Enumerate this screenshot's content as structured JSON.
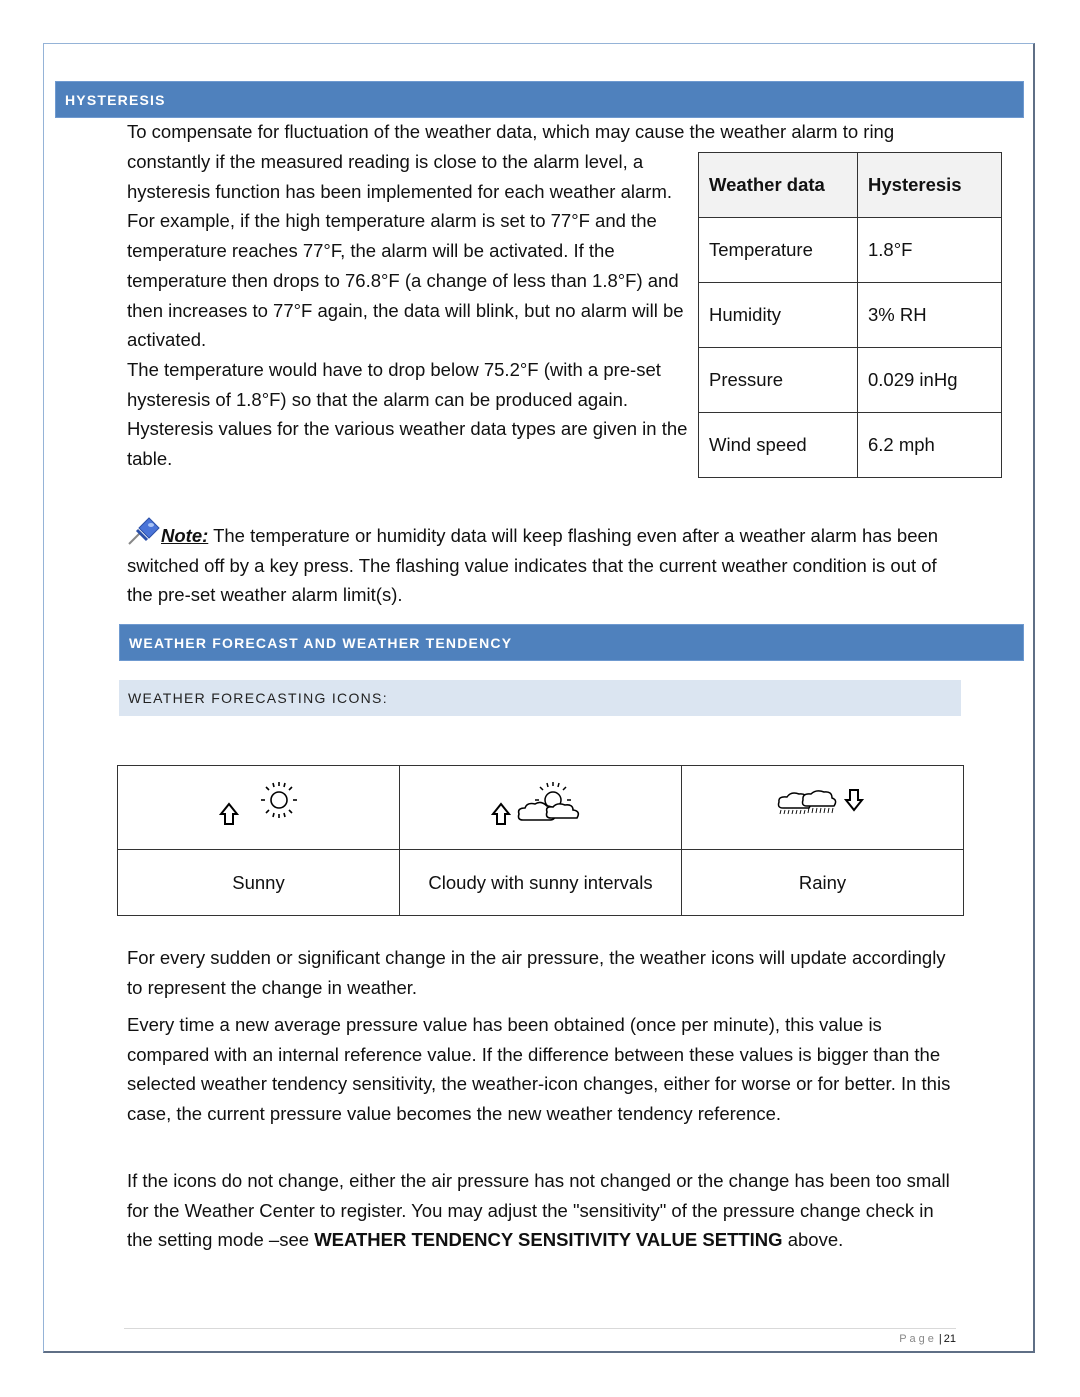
{
  "sections": {
    "hysteresis_title": "HYSTERESIS",
    "forecast_title": "WEATHER FORECAST AND WEATHER TENDENCY",
    "icons_subtitle": "WEATHER FORECASTING ICONS:"
  },
  "hysteresis": {
    "intro_line": "To compensate for fluctuation of the weather data, which may cause the weather alarm to ring",
    "left_text_1": "constantly if the measured reading is close to the alarm level, a hysteresis function has been implemented for each weather alarm.",
    "left_text_2": "For example, if the high temperature alarm is set to 77°F and the temperature reaches 77°F, the alarm will be activated. If the temperature then drops to 76.8°F (a change of less than 1.8°F) and then increases to 77°F again, the data will blink, but no alarm will be activated.",
    "left_text_3": "The temperature would have to drop below 75.2°F (with a pre-set hysteresis of 1.8°F) so that the alarm can be produced again. Hysteresis values for the various weather data types are given in the table.",
    "table": {
      "headers": [
        "Weather data",
        "Hysteresis"
      ],
      "rows": [
        [
          "Temperature",
          "1.8°F"
        ],
        [
          "Humidity",
          "3% RH"
        ],
        [
          "Pressure",
          "0.029 inHg"
        ],
        [
          "Wind speed",
          "6.2 mph"
        ]
      ]
    },
    "note_label": "Note:",
    "note_text": " The temperature or humidity data will keep flashing even after a weather alarm has been switched off by a key press. The flashing value indicates that the current weather condition is out of the pre-set weather alarm limit(s)."
  },
  "forecast": {
    "icons": [
      {
        "label": "Sunny",
        "icon": "sunny-icon",
        "tendency": "up-arrow-icon"
      },
      {
        "label": "Cloudy with sunny intervals",
        "icon": "partly-cloudy-icon",
        "tendency": "up-arrow-icon"
      },
      {
        "label": "Rainy",
        "icon": "rainy-icon",
        "tendency": "down-arrow-icon"
      }
    ],
    "para1": "For every sudden or significant change in the air pressure, the weather icons will update accordingly to represent the change in weather.",
    "para2": "Every time a new average pressure value has been obtained (once per minute), this value is compared with an internal reference value. If the difference between these values is bigger than the selected weather tendency sensitivity, the weather-icon changes, either for worse or for better. In this case, the current pressure value becomes the new weather tendency reference.",
    "para3_a": "If the icons do not change, either the air pressure has not changed or the change has been too small for the Weather Center to register. You may adjust the \"sensitivity\" of the pressure change check in the setting mode –see ",
    "para3_bold": "WEATHER TENDENCY SENSITIVITY VALUE SETTING",
    "para3_b": " above."
  },
  "footer": {
    "page_label": "Page",
    "page_number": "21"
  },
  "colors": {
    "section_bar": "#4F81BD",
    "subheader_bg": "#DBE5F1",
    "table_header_bg": "#F2F2F2"
  }
}
